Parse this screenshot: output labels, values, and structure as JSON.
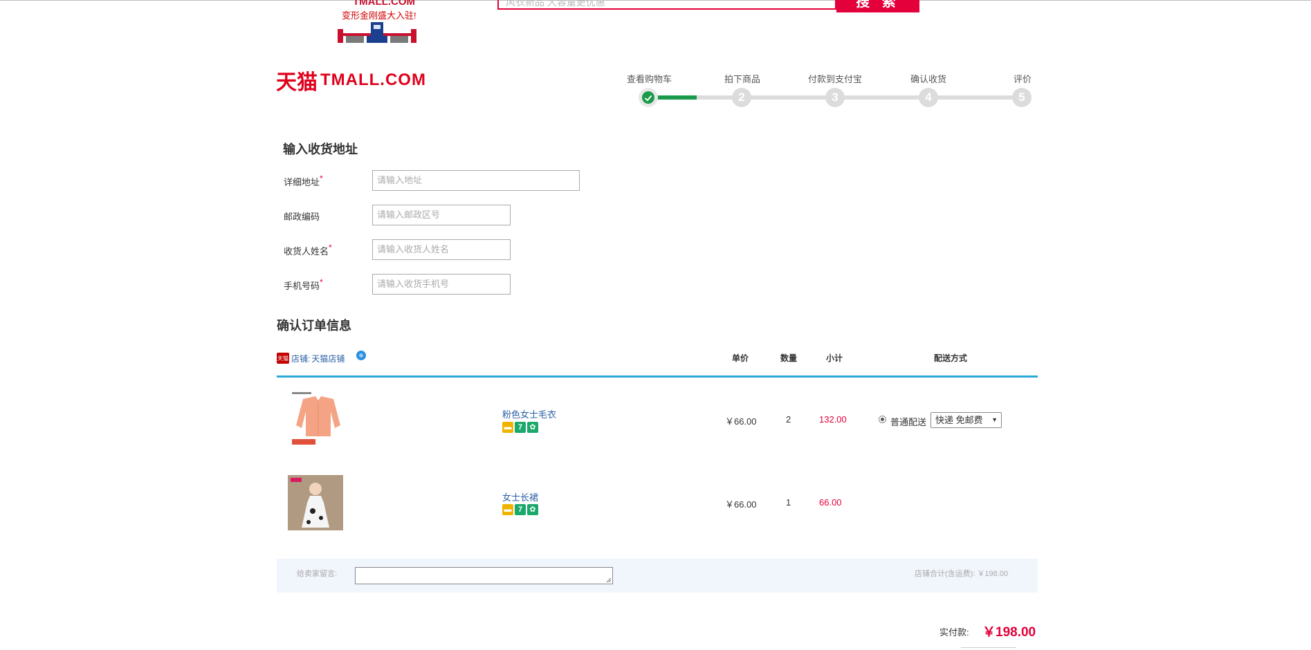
{
  "promo": {
    "site": "TMALL.COM",
    "tagline": "变形金刚盛大入驻!"
  },
  "search": {
    "placeholder": "风衣新品 大容量更优惠",
    "button": "搜 索"
  },
  "logo": {
    "cn": "天猫",
    "en": "TMALL.COM"
  },
  "steps": [
    {
      "label": "查看购物车",
      "number": "",
      "state": "done"
    },
    {
      "label": "拍下商品",
      "number": "2",
      "state": "todo"
    },
    {
      "label": "付款到支付宝",
      "number": "3",
      "state": "todo"
    },
    {
      "label": "确认收货",
      "number": "4",
      "state": "todo"
    },
    {
      "label": "评价",
      "number": "5",
      "state": "todo"
    }
  ],
  "address": {
    "title": "输入收货地址",
    "fields": [
      {
        "label": "详细地址",
        "required": "*",
        "placeholder": "请输入地址"
      },
      {
        "label": "邮政编码",
        "required": "",
        "placeholder": "请输入邮政区号"
      },
      {
        "label": "收货人姓名",
        "required": "*",
        "placeholder": "请输入收货人姓名"
      },
      {
        "label": "手机号码",
        "required": "*",
        "placeholder": "请输入收货手机号"
      }
    ]
  },
  "order": {
    "title": "确认订单信息",
    "shop_prefix": "店铺:",
    "shop_name": "天猫店铺",
    "tmall_badge": "天猫",
    "columns": {
      "price": "单价",
      "qty": "数量",
      "subtotal": "小计",
      "shipping": "配送方式"
    },
    "items": [
      {
        "name": "粉色女士毛衣",
        "price": "￥66.00",
        "qty": "2",
        "subtotal": "132.00",
        "image": "pink-sweater"
      },
      {
        "name": "女士长裙",
        "price": "￥66.00",
        "qty": "1",
        "subtotal": "66.00",
        "image": "dress"
      }
    ],
    "shipping_option": "普通配送",
    "shipping_select": "快递 免邮费",
    "message_label": "给卖家留言:",
    "shop_total": "店铺合计(含运费): ￥198.00",
    "pay_label": "实付款:",
    "pay_amount": "￥198.00"
  },
  "colors": {
    "brand": "#e4003a",
    "progress": "#1a9a4a",
    "table_rule": "#2aa7d8"
  }
}
